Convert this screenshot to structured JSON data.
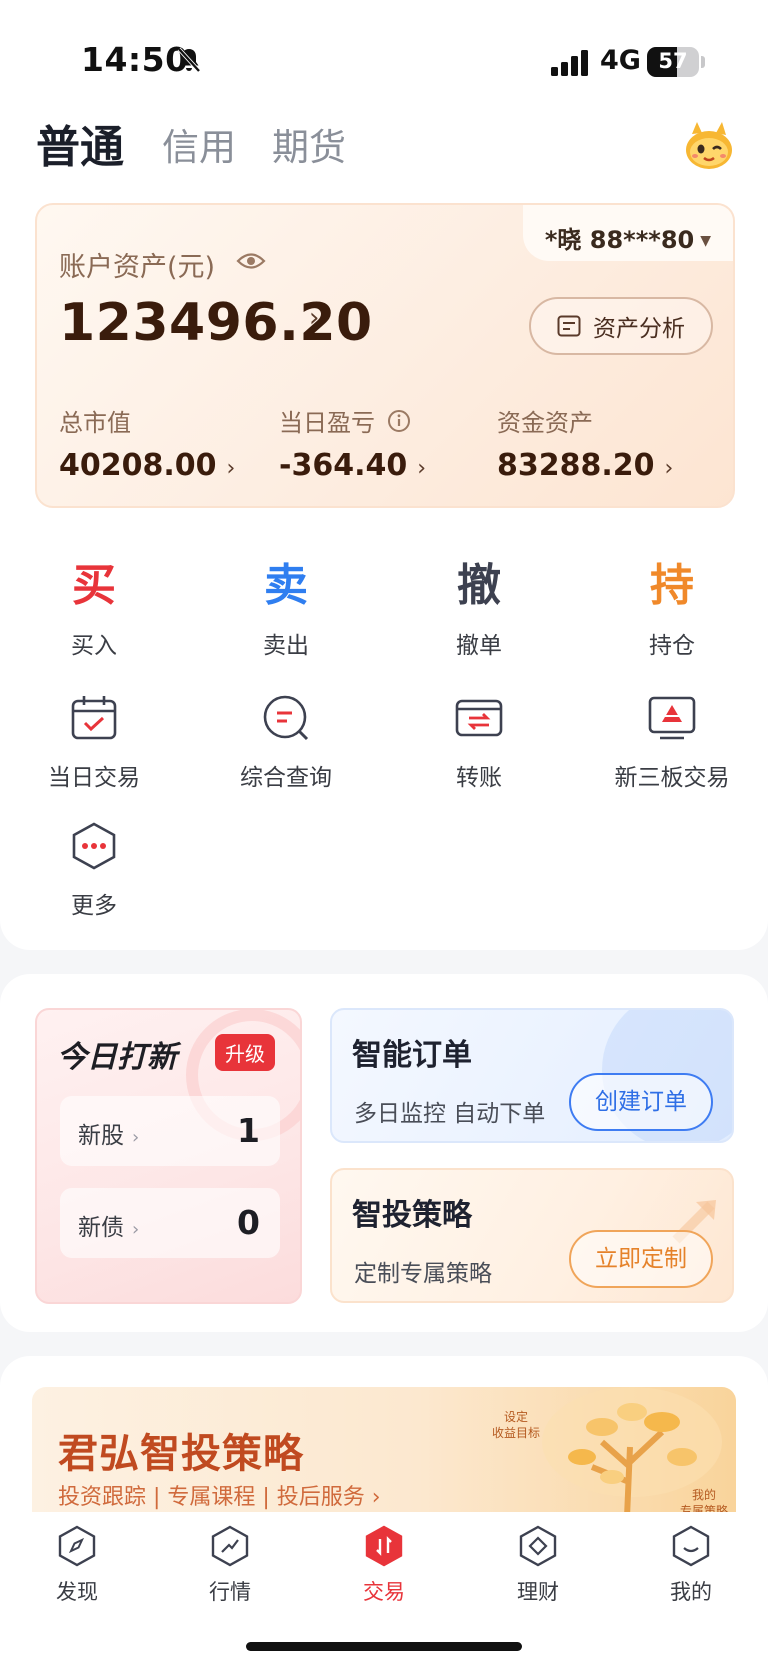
{
  "status_bar": {
    "time": "14:50",
    "network": "4G",
    "battery": "57"
  },
  "tabs": [
    {
      "label": "普通",
      "active": true
    },
    {
      "label": "信用",
      "active": false
    },
    {
      "label": "期货",
      "active": false
    }
  ],
  "asset_card": {
    "account": "*晓 88***80",
    "label": "账户资产(元)",
    "value": "123496.20",
    "analysis_button": "资产分析",
    "stats": [
      {
        "label": "总市值",
        "value": "40208.00"
      },
      {
        "label": "当日盈亏",
        "value": "-364.40"
      },
      {
        "label": "资金资产",
        "value": "83288.20"
      }
    ]
  },
  "quick_actions": [
    {
      "glyph": "买",
      "label": "买入",
      "color": "#e8343a"
    },
    {
      "glyph": "卖",
      "label": "卖出",
      "color": "#2f7ef0"
    },
    {
      "glyph": "撤",
      "label": "撤单",
      "color": "#3d4150"
    },
    {
      "glyph": "持",
      "label": "持仓",
      "color": "#f0892a"
    }
  ],
  "tools": [
    {
      "label": "当日交易",
      "icon": "calendar-check-icon"
    },
    {
      "label": "综合查询",
      "icon": "search-query-icon"
    },
    {
      "label": "转账",
      "icon": "transfer-icon"
    },
    {
      "label": "新三板交易",
      "icon": "board-trade-icon"
    },
    {
      "label": "更多",
      "icon": "more-icon"
    }
  ],
  "ipo": {
    "title": "今日打新",
    "badge": "升级",
    "rows": [
      {
        "label": "新股",
        "value": "1"
      },
      {
        "label": "新债",
        "value": "0"
      }
    ]
  },
  "smart_order": {
    "title": "智能订单",
    "subtitle": "多日监控 自动下单",
    "button": "创建订单"
  },
  "strategy": {
    "title": "智投策略",
    "subtitle": "定制专属策略",
    "button": "立即定制"
  },
  "banner": {
    "title": "君弘智投策略",
    "subtitle": "投资跟踪 | 专属课程 | 投后服务 ›",
    "tag1": "设定\n收益目标",
    "tag2": "我的\n专属策略"
  },
  "bottom_nav": [
    {
      "label": "发现",
      "icon": "compass-icon",
      "active": false
    },
    {
      "label": "行情",
      "icon": "market-trend-icon",
      "active": false
    },
    {
      "label": "交易",
      "icon": "trade-icon",
      "active": true
    },
    {
      "label": "理财",
      "icon": "wealth-icon",
      "active": false
    },
    {
      "label": "我的",
      "icon": "profile-icon",
      "active": false
    }
  ],
  "colors": {
    "accent_red": "#e8343a",
    "accent_blue": "#2f7ef0",
    "accent_orange": "#f0892a",
    "asset_dark": "#3a1c0c"
  }
}
